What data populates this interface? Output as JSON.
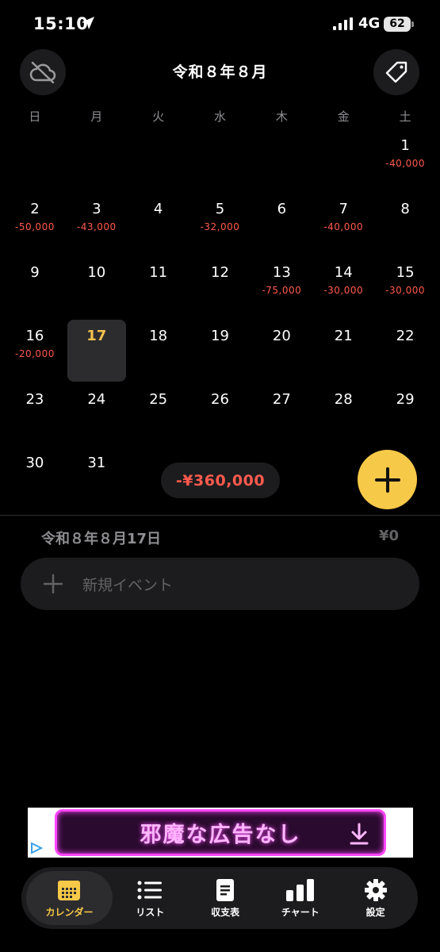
{
  "status": {
    "time": "15:10",
    "network": "4G",
    "battery": "62"
  },
  "header": {
    "title": "令和８年８月"
  },
  "weekdays": [
    "日",
    "月",
    "火",
    "水",
    "木",
    "金",
    "土"
  ],
  "calendar": {
    "weeks": [
      [
        {
          "d": "",
          "a": ""
        },
        {
          "d": "",
          "a": ""
        },
        {
          "d": "",
          "a": ""
        },
        {
          "d": "",
          "a": ""
        },
        {
          "d": "",
          "a": ""
        },
        {
          "d": "",
          "a": ""
        },
        {
          "d": "1",
          "a": "-40,000"
        }
      ],
      [
        {
          "d": "2",
          "a": "-50,000"
        },
        {
          "d": "3",
          "a": "-43,000"
        },
        {
          "d": "4",
          "a": ""
        },
        {
          "d": "5",
          "a": "-32,000"
        },
        {
          "d": "6",
          "a": ""
        },
        {
          "d": "7",
          "a": "-40,000"
        },
        {
          "d": "8",
          "a": ""
        }
      ],
      [
        {
          "d": "9",
          "a": ""
        },
        {
          "d": "10",
          "a": ""
        },
        {
          "d": "11",
          "a": ""
        },
        {
          "d": "12",
          "a": ""
        },
        {
          "d": "13",
          "a": "-75,000"
        },
        {
          "d": "14",
          "a": "-30,000"
        },
        {
          "d": "15",
          "a": "-30,000"
        }
      ],
      [
        {
          "d": "16",
          "a": "-20,000"
        },
        {
          "d": "17",
          "a": "",
          "selected": true
        },
        {
          "d": "18",
          "a": ""
        },
        {
          "d": "19",
          "a": ""
        },
        {
          "d": "20",
          "a": ""
        },
        {
          "d": "21",
          "a": ""
        },
        {
          "d": "22",
          "a": ""
        }
      ],
      [
        {
          "d": "23",
          "a": ""
        },
        {
          "d": "24",
          "a": ""
        },
        {
          "d": "25",
          "a": ""
        },
        {
          "d": "26",
          "a": ""
        },
        {
          "d": "27",
          "a": ""
        },
        {
          "d": "28",
          "a": ""
        },
        {
          "d": "29",
          "a": ""
        }
      ],
      [
        {
          "d": "30",
          "a": ""
        },
        {
          "d": "31",
          "a": ""
        },
        {
          "d": "",
          "a": ""
        },
        {
          "d": "",
          "a": ""
        },
        {
          "d": "",
          "a": ""
        },
        {
          "d": "",
          "a": ""
        },
        {
          "d": "",
          "a": ""
        }
      ]
    ]
  },
  "month_total": "-¥360,000",
  "day_detail": {
    "title": "令和８年８月17日",
    "total": "¥0",
    "new_event_label": "新規イベント"
  },
  "ad": {
    "text": "邪魔な広告なし"
  },
  "tabs": [
    {
      "label": "カレンダー",
      "icon": "calendar-icon",
      "active": true
    },
    {
      "label": "リスト",
      "icon": "list-icon"
    },
    {
      "label": "収支表",
      "icon": "document-icon"
    },
    {
      "label": "チャート",
      "icon": "chart-icon"
    },
    {
      "label": "設定",
      "icon": "gear-icon"
    }
  ],
  "colors": {
    "accent": "#f7c948",
    "expense": "#ff5a4e",
    "surface": "#1c1c1e"
  }
}
